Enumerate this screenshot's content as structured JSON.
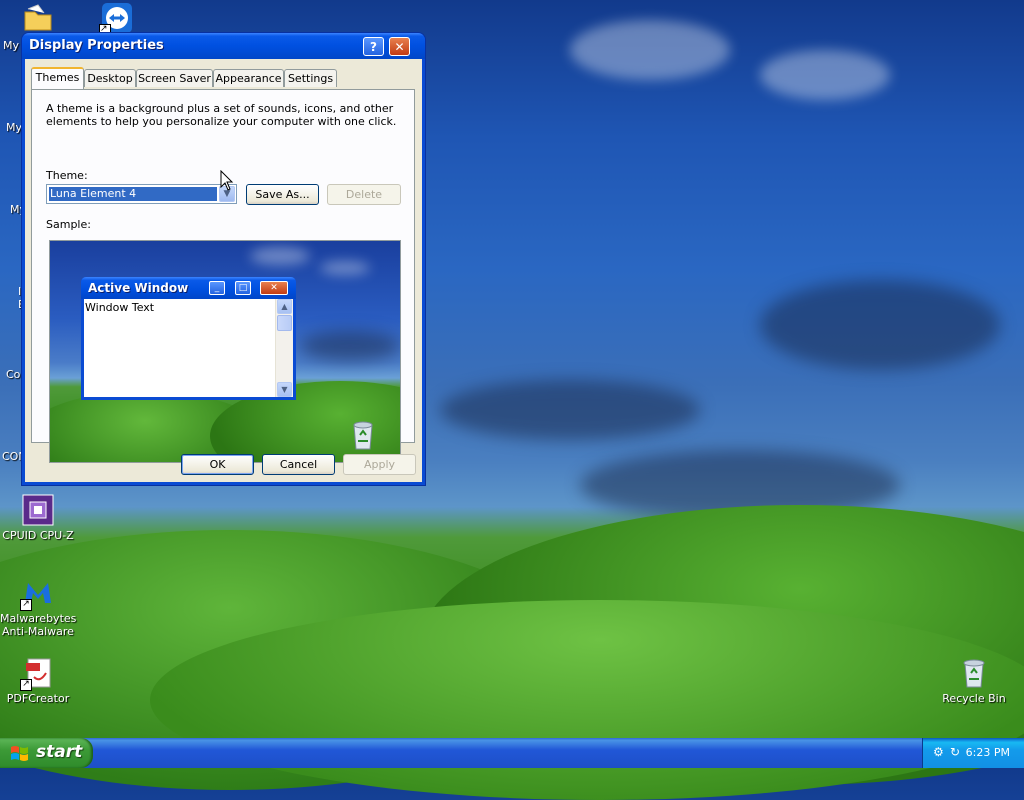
{
  "desktop": {
    "partial_labels": [
      "My I",
      "My",
      "My",
      "I",
      "E",
      "Co",
      "CON"
    ],
    "icons": [
      {
        "label": "CPUID CPU-Z"
      },
      {
        "label": "Malwarebytes Anti-Malware"
      },
      {
        "label": "PDFCreator"
      },
      {
        "label": "Recycle Bin"
      }
    ]
  },
  "dialog": {
    "title": "Display Properties",
    "help_glyph": "?",
    "close_glyph": "✕",
    "tabs": [
      "Themes",
      "Desktop",
      "Screen Saver",
      "Appearance",
      "Settings"
    ],
    "active_tab": "Themes",
    "description": "A theme is a background plus a set of sounds, icons, and other elements to help you personalize your computer with one click.",
    "theme_label": "Theme:",
    "theme_value": "Luna Element 4",
    "save_as_label": "Save As...",
    "delete_label": "Delete",
    "sample_label": "Sample:",
    "sample": {
      "window_title": "Active Window",
      "window_text": "Window Text"
    },
    "ok_label": "OK",
    "cancel_label": "Cancel",
    "apply_label": "Apply"
  },
  "taskbar": {
    "start_label": "start",
    "clock": "6:23 PM"
  }
}
